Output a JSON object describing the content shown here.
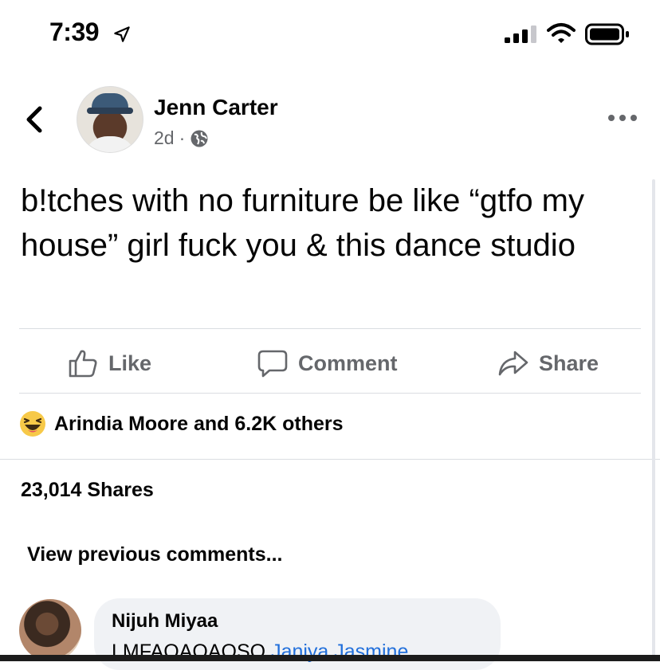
{
  "status_bar": {
    "time": "7:39"
  },
  "post": {
    "author": "Jenn Carter",
    "age": "2d",
    "separator": "·",
    "audience_icon": "globe-icon",
    "text": "b!tches with no furniture be like “gtfo my house” girl fuck you & this dance studio"
  },
  "actions": {
    "like": "Like",
    "comment": "Comment",
    "share": "Share"
  },
  "reactions": {
    "icon": "haha-reaction-icon",
    "summary": "Arindia Moore and 6.2K others"
  },
  "shares": "23,014 Shares",
  "view_previous": "View previous comments...",
  "comment": {
    "author": "Nijuh Miyaa",
    "text": "LMFAOAOAOSO",
    "tags": "Janiya Jasmine"
  },
  "colors": {
    "secondary_text": "#65676b",
    "tag_blue": "#216fdb",
    "bubble_bg": "#f0f2f5",
    "divider": "#dadde1"
  }
}
